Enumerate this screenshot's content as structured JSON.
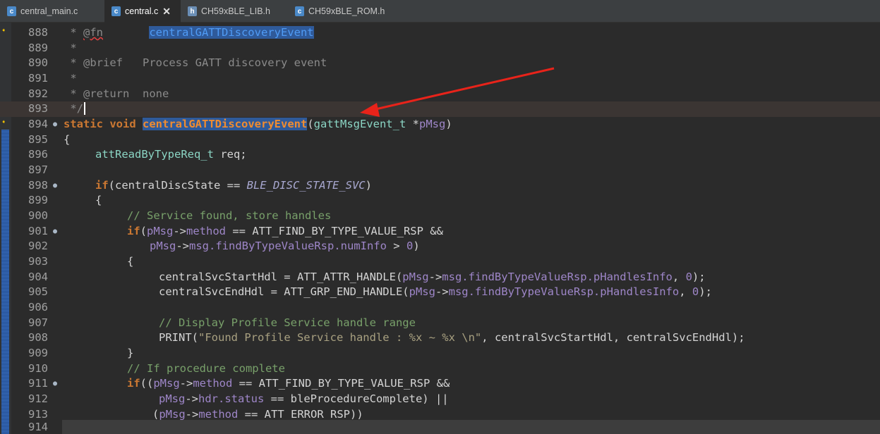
{
  "tabs": [
    {
      "label": "central_main.c",
      "icon": "c-file-icon",
      "active": false
    },
    {
      "label": "central.c",
      "icon": "c-file-icon",
      "active": true,
      "close": "✕"
    },
    {
      "label": "CH59xBLE_LIB.h",
      "icon": "h-file-icon",
      "active": false
    },
    {
      "label": "CH59xBLE_ROM.h",
      "icon": "c-file-icon",
      "active": false
    }
  ],
  "lines": [
    {
      "n": "888"
    },
    {
      "n": "889"
    },
    {
      "n": "890"
    },
    {
      "n": "891"
    },
    {
      "n": "892"
    },
    {
      "n": "893"
    },
    {
      "n": "894"
    },
    {
      "n": "895"
    },
    {
      "n": "896"
    },
    {
      "n": "897"
    },
    {
      "n": "898"
    },
    {
      "n": "899"
    },
    {
      "n": "900"
    },
    {
      "n": "901"
    },
    {
      "n": "902"
    },
    {
      "n": "903"
    },
    {
      "n": "904"
    },
    {
      "n": "905"
    },
    {
      "n": "906"
    },
    {
      "n": "907"
    },
    {
      "n": "908"
    },
    {
      "n": "909"
    },
    {
      "n": "910"
    },
    {
      "n": "911"
    },
    {
      "n": "912"
    },
    {
      "n": "913"
    },
    {
      "n": "914"
    }
  ],
  "code": {
    "l888": {
      "star": " * ",
      "tag": "@fn",
      "pad": "       ",
      "fn": "centralGATTDiscoveryEvent"
    },
    "l889": " *",
    "l890": {
      "star": " * ",
      "tag": "@brief",
      "pad": "   ",
      "text": "Process GATT discovery event"
    },
    "l891": " *",
    "l892": {
      "star": " * ",
      "tag": "@return",
      "pad": "  ",
      "text": "none"
    },
    "l893": " */",
    "l894": {
      "kw1": "static",
      "kw2": "void",
      "fn": "centralGATTDiscoveryEvent",
      "open": "(",
      "type": "gattMsgEvent_t",
      "star": " *",
      "param": "pMsg",
      "close": ")"
    },
    "l895": "{",
    "l896": {
      "type": "attReadByTypeReq_t",
      "var": " req;"
    },
    "l897": "",
    "l898": {
      "kw": "if",
      "open": "(centralDiscState == ",
      "macro": "BLE_DISC_STATE_SVC",
      "close": ")"
    },
    "l899": "{",
    "l900": "// Service found, store handles",
    "l901": {
      "kw": "if",
      "a": "(",
      "p": "pMsg",
      "b": "->",
      "f": "method",
      "c": " == ATT_FIND_BY_TYPE_VALUE_RSP &&"
    },
    "l902": {
      "p": "pMsg",
      "b": "->",
      "f": "msg.findByTypeValueRsp.numInfo",
      "c": " > ",
      "num": "0",
      "d": ")"
    },
    "l903": "{",
    "l904": {
      "a": "centralSvcStartHdl = ATT_ATTR_HANDLE(",
      "p": "pMsg",
      "b": "->",
      "f": "msg.findByTypeValueRsp.pHandlesInfo",
      "c": ", ",
      "num": "0",
      "d": ");"
    },
    "l905": {
      "a": "centralSvcEndHdl = ATT_GRP_END_HANDLE(",
      "p": "pMsg",
      "b": "->",
      "f": "msg.findByTypeValueRsp.pHandlesInfo",
      "c": ", ",
      "num": "0",
      "d": ");"
    },
    "l906": "",
    "l907": "// Display Profile Service handle range",
    "l908": {
      "a": "PRINT(",
      "s": "\"Found Profile Service handle : %x ~ %x \\n\"",
      "c": ", centralSvcStartHdl, centralSvcEndHdl);"
    },
    "l909": "}",
    "l910": "// If procedure complete",
    "l911": {
      "kw": "if",
      "a": "((",
      "p": "pMsg",
      "b": "->",
      "f": "method",
      "c": " == ATT_FIND_BY_TYPE_VALUE_RSP &&"
    },
    "l912": {
      "p": "pMsg",
      "b": "->",
      "f": "hdr.status",
      "c": " == bleProcedureComplete) ||"
    },
    "l913": {
      "a": "(",
      "p": "pMsg",
      "b": "->",
      "f": "method",
      "c": " == ATT_ERROR_RSP))"
    },
    "l914": ""
  },
  "colors": {
    "annotation_arrow": "#e8231a",
    "selection": "#2f5a9a",
    "keyword": "#cc7832"
  }
}
